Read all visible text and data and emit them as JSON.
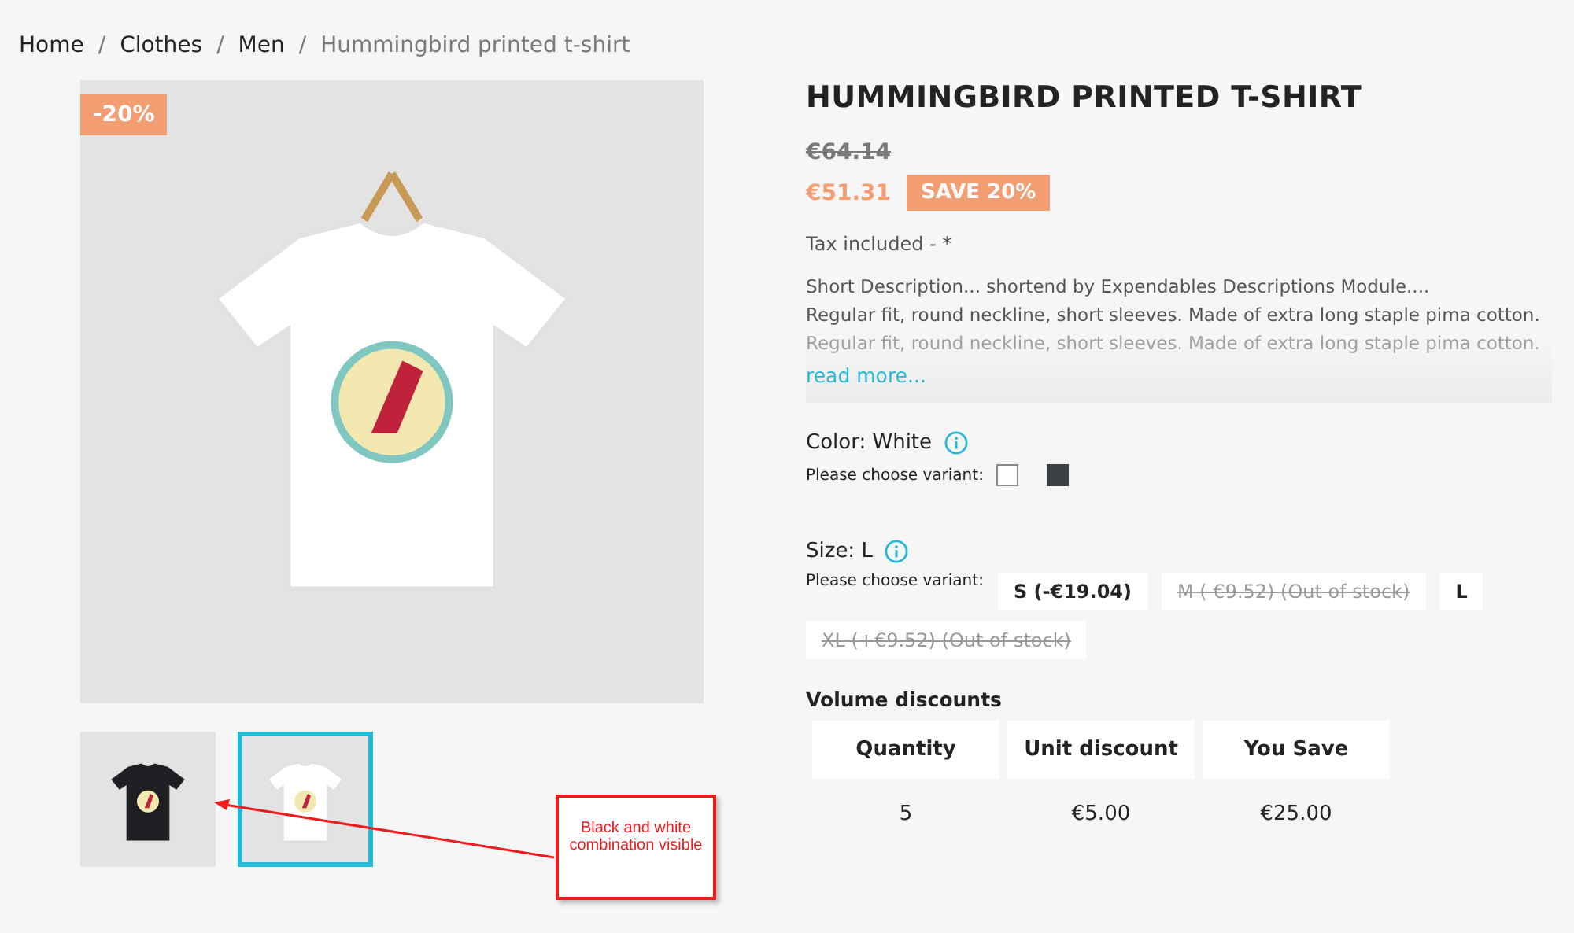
{
  "breadcrumb": [
    {
      "label": "Home",
      "current": false
    },
    {
      "label": "Clothes",
      "current": false
    },
    {
      "label": "Men",
      "current": false
    },
    {
      "label": "Hummingbird printed t-shirt",
      "current": true
    }
  ],
  "breadcrumb_separator": "/",
  "product": {
    "badge": "-20%",
    "title": "HUMMINGBIRD PRINTED T-SHIRT",
    "old_price": "€64.14",
    "price": "€51.31",
    "save_badge": "SAVE 20%",
    "tax_note": "Tax included - *",
    "description": [
      "Short Description... shortend by Expendables Descriptions Module....",
      "Regular fit, round neckline, short sleeves. Made of extra long staple pima cotton.",
      "Regular fit, round neckline, short sleeves. Made of extra long staple pima cotton."
    ],
    "read_more": "read more..."
  },
  "thumbnails": [
    {
      "color": "#1e1f22",
      "selected": false
    },
    {
      "color": "#ffffff",
      "selected": true
    }
  ],
  "annotation": "Black and white combination visible",
  "color_option": {
    "label": "Color: White",
    "hint": "Please choose variant:",
    "swatches": [
      {
        "color": "#ffffff",
        "selected": true
      },
      {
        "color": "#3a3f45",
        "selected": false
      }
    ]
  },
  "size_option": {
    "label": "Size: L",
    "hint": "Please choose variant:",
    "options": [
      {
        "label": "S (-€19.04)",
        "disabled": false
      },
      {
        "label": "M ( €9.52) (Out of stock)",
        "disabled": true
      },
      {
        "label": "L",
        "disabled": false
      },
      {
        "label": "XL (+€9.52) (Out of stock)",
        "disabled": true
      }
    ]
  },
  "volume_discounts": {
    "title": "Volume discounts",
    "columns": [
      "Quantity",
      "Unit discount",
      "You Save"
    ],
    "rows": [
      [
        "5",
        "€5.00",
        "€25.00"
      ]
    ]
  }
}
